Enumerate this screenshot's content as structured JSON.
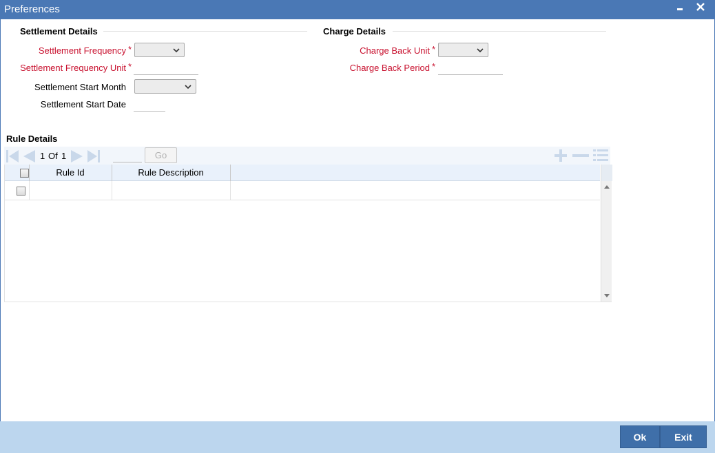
{
  "window": {
    "title": "Preferences",
    "minimize_glyph": "▬",
    "close_glyph": "✕"
  },
  "settlement": {
    "heading": "Settlement Details",
    "frequency_label": "Settlement Frequency",
    "frequency_unit_label": "Settlement Frequency Unit",
    "start_month_label": "Settlement Start Month",
    "start_date_label": "Settlement Start Date",
    "required_mark": "*"
  },
  "charge": {
    "heading": "Charge Details",
    "back_unit_label": "Charge Back Unit",
    "back_period_label": "Charge Back Period",
    "required_mark": "*"
  },
  "rules": {
    "heading": "Rule Details",
    "pager": {
      "current": "1",
      "of_label": "Of",
      "total": "1",
      "go_label": "Go"
    },
    "columns": [
      "Rule Id",
      "Rule Description"
    ],
    "rows": [
      {
        "rule_id": "",
        "rule_description": ""
      }
    ]
  },
  "footer": {
    "ok_label": "Ok",
    "exit_label": "Exit"
  },
  "colors": {
    "titlebar": "#4a78b5",
    "required": "#c8102e",
    "footer": "#bcd6ee",
    "button": "#3f6fa9"
  }
}
